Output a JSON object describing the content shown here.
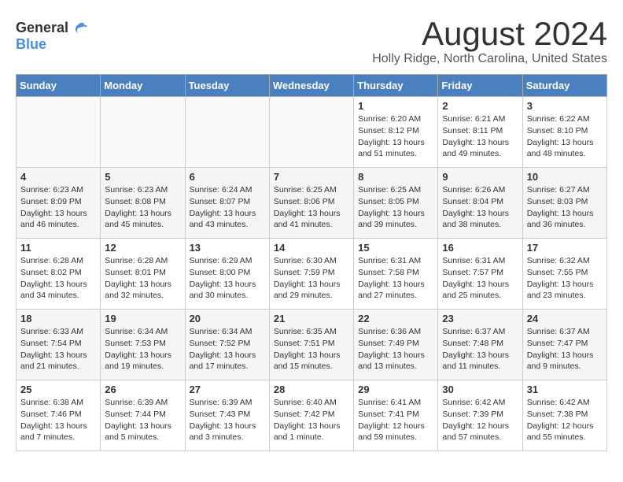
{
  "logo": {
    "general": "General",
    "blue": "Blue"
  },
  "title": "August 2024",
  "location": "Holly Ridge, North Carolina, United States",
  "days_of_week": [
    "Sunday",
    "Monday",
    "Tuesday",
    "Wednesday",
    "Thursday",
    "Friday",
    "Saturday"
  ],
  "weeks": [
    [
      {
        "day": "",
        "detail": ""
      },
      {
        "day": "",
        "detail": ""
      },
      {
        "day": "",
        "detail": ""
      },
      {
        "day": "",
        "detail": ""
      },
      {
        "day": "1",
        "detail": "Sunrise: 6:20 AM\nSunset: 8:12 PM\nDaylight: 13 hours\nand 51 minutes."
      },
      {
        "day": "2",
        "detail": "Sunrise: 6:21 AM\nSunset: 8:11 PM\nDaylight: 13 hours\nand 49 minutes."
      },
      {
        "day": "3",
        "detail": "Sunrise: 6:22 AM\nSunset: 8:10 PM\nDaylight: 13 hours\nand 48 minutes."
      }
    ],
    [
      {
        "day": "4",
        "detail": "Sunrise: 6:23 AM\nSunset: 8:09 PM\nDaylight: 13 hours\nand 46 minutes."
      },
      {
        "day": "5",
        "detail": "Sunrise: 6:23 AM\nSunset: 8:08 PM\nDaylight: 13 hours\nand 45 minutes."
      },
      {
        "day": "6",
        "detail": "Sunrise: 6:24 AM\nSunset: 8:07 PM\nDaylight: 13 hours\nand 43 minutes."
      },
      {
        "day": "7",
        "detail": "Sunrise: 6:25 AM\nSunset: 8:06 PM\nDaylight: 13 hours\nand 41 minutes."
      },
      {
        "day": "8",
        "detail": "Sunrise: 6:25 AM\nSunset: 8:05 PM\nDaylight: 13 hours\nand 39 minutes."
      },
      {
        "day": "9",
        "detail": "Sunrise: 6:26 AM\nSunset: 8:04 PM\nDaylight: 13 hours\nand 38 minutes."
      },
      {
        "day": "10",
        "detail": "Sunrise: 6:27 AM\nSunset: 8:03 PM\nDaylight: 13 hours\nand 36 minutes."
      }
    ],
    [
      {
        "day": "11",
        "detail": "Sunrise: 6:28 AM\nSunset: 8:02 PM\nDaylight: 13 hours\nand 34 minutes."
      },
      {
        "day": "12",
        "detail": "Sunrise: 6:28 AM\nSunset: 8:01 PM\nDaylight: 13 hours\nand 32 minutes."
      },
      {
        "day": "13",
        "detail": "Sunrise: 6:29 AM\nSunset: 8:00 PM\nDaylight: 13 hours\nand 30 minutes."
      },
      {
        "day": "14",
        "detail": "Sunrise: 6:30 AM\nSunset: 7:59 PM\nDaylight: 13 hours\nand 29 minutes."
      },
      {
        "day": "15",
        "detail": "Sunrise: 6:31 AM\nSunset: 7:58 PM\nDaylight: 13 hours\nand 27 minutes."
      },
      {
        "day": "16",
        "detail": "Sunrise: 6:31 AM\nSunset: 7:57 PM\nDaylight: 13 hours\nand 25 minutes."
      },
      {
        "day": "17",
        "detail": "Sunrise: 6:32 AM\nSunset: 7:55 PM\nDaylight: 13 hours\nand 23 minutes."
      }
    ],
    [
      {
        "day": "18",
        "detail": "Sunrise: 6:33 AM\nSunset: 7:54 PM\nDaylight: 13 hours\nand 21 minutes."
      },
      {
        "day": "19",
        "detail": "Sunrise: 6:34 AM\nSunset: 7:53 PM\nDaylight: 13 hours\nand 19 minutes."
      },
      {
        "day": "20",
        "detail": "Sunrise: 6:34 AM\nSunset: 7:52 PM\nDaylight: 13 hours\nand 17 minutes."
      },
      {
        "day": "21",
        "detail": "Sunrise: 6:35 AM\nSunset: 7:51 PM\nDaylight: 13 hours\nand 15 minutes."
      },
      {
        "day": "22",
        "detail": "Sunrise: 6:36 AM\nSunset: 7:49 PM\nDaylight: 13 hours\nand 13 minutes."
      },
      {
        "day": "23",
        "detail": "Sunrise: 6:37 AM\nSunset: 7:48 PM\nDaylight: 13 hours\nand 11 minutes."
      },
      {
        "day": "24",
        "detail": "Sunrise: 6:37 AM\nSunset: 7:47 PM\nDaylight: 13 hours\nand 9 minutes."
      }
    ],
    [
      {
        "day": "25",
        "detail": "Sunrise: 6:38 AM\nSunset: 7:46 PM\nDaylight: 13 hours\nand 7 minutes."
      },
      {
        "day": "26",
        "detail": "Sunrise: 6:39 AM\nSunset: 7:44 PM\nDaylight: 13 hours\nand 5 minutes."
      },
      {
        "day": "27",
        "detail": "Sunrise: 6:39 AM\nSunset: 7:43 PM\nDaylight: 13 hours\nand 3 minutes."
      },
      {
        "day": "28",
        "detail": "Sunrise: 6:40 AM\nSunset: 7:42 PM\nDaylight: 13 hours\nand 1 minute."
      },
      {
        "day": "29",
        "detail": "Sunrise: 6:41 AM\nSunset: 7:41 PM\nDaylight: 12 hours\nand 59 minutes."
      },
      {
        "day": "30",
        "detail": "Sunrise: 6:42 AM\nSunset: 7:39 PM\nDaylight: 12 hours\nand 57 minutes."
      },
      {
        "day": "31",
        "detail": "Sunrise: 6:42 AM\nSunset: 7:38 PM\nDaylight: 12 hours\nand 55 minutes."
      }
    ]
  ]
}
